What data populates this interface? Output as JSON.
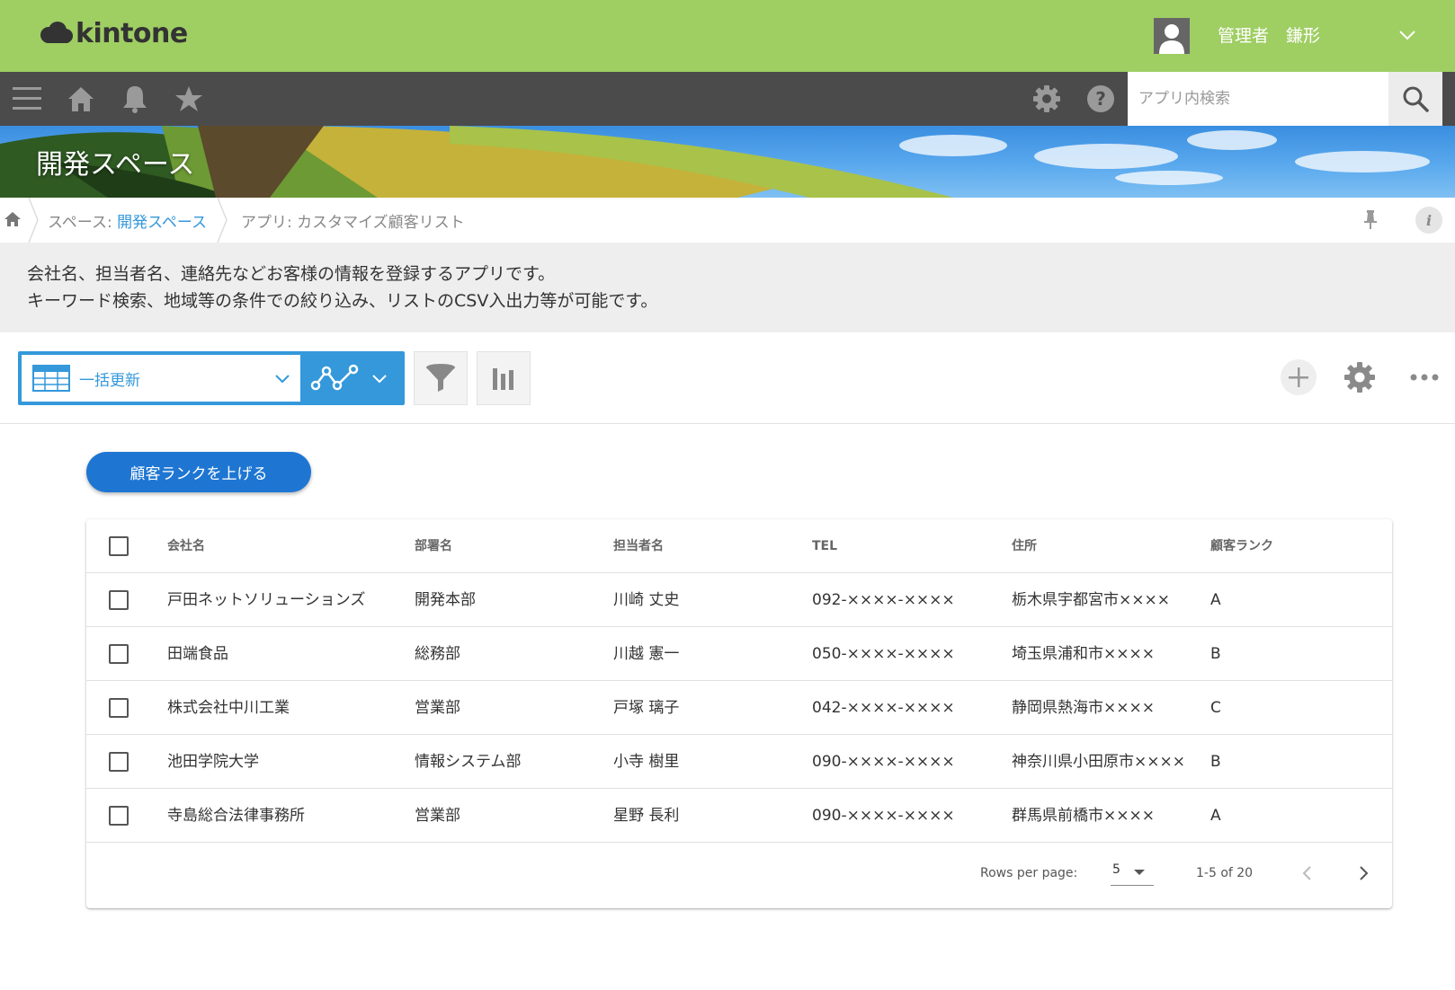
{
  "header": {
    "logo_text": "kintone",
    "user_name": "管理者　鎌形"
  },
  "navbar": {
    "search_placeholder": "アプリ内検索",
    "icons": [
      "menu-icon",
      "home-icon",
      "bell-icon",
      "star-icon",
      "gear-icon",
      "help-icon",
      "search-icon"
    ]
  },
  "space": {
    "title": "開発スペース"
  },
  "breadcrumb": {
    "space_prefix": "スペース: ",
    "space_link": "開発スペース",
    "app": "アプリ: カスタマイズ顧客リスト"
  },
  "description": {
    "line1": "会社名、担当者名、連絡先などお客様の情報を登録するアプリです。",
    "line2": "キーワード検索、地域等の条件での絞り込み、リストのCSV入出力等が可能です。"
  },
  "toolbar": {
    "view_name": "一括更新"
  },
  "action_button": "顧客ランクを上げる",
  "table": {
    "columns": [
      "会社名",
      "部署名",
      "担当者名",
      "TEL",
      "住所",
      "顧客ランク"
    ],
    "rows": [
      [
        "戸田ネットソリューションズ",
        "開発本部",
        "川崎 丈史",
        "092-××××-××××",
        "栃木県宇都宮市××××",
        "A"
      ],
      [
        "田端食品",
        "総務部",
        "川越 憲一",
        "050-××××-××××",
        "埼玉県浦和市××××",
        "B"
      ],
      [
        "株式会社中川工業",
        "営業部",
        "戸塚 璃子",
        "042-××××-××××",
        "静岡県熱海市××××",
        "C"
      ],
      [
        "池田学院大学",
        "情報システム部",
        "小寺 樹里",
        "090-××××-××××",
        "神奈川県小田原市××××",
        "B"
      ],
      [
        "寺島総合法律事務所",
        "営業部",
        "星野 長利",
        "090-××××-××××",
        "群馬県前橋市××××",
        "A"
      ]
    ]
  },
  "pagination": {
    "rows_per_page_label": "Rows per page:",
    "rows_per_page_value": "5",
    "range": "1-5 of 20"
  },
  "colors": {
    "topbar": "#9fce63",
    "navbar": "#4b4b4b",
    "accent": "#3498db",
    "action_button": "#1e76d2"
  }
}
